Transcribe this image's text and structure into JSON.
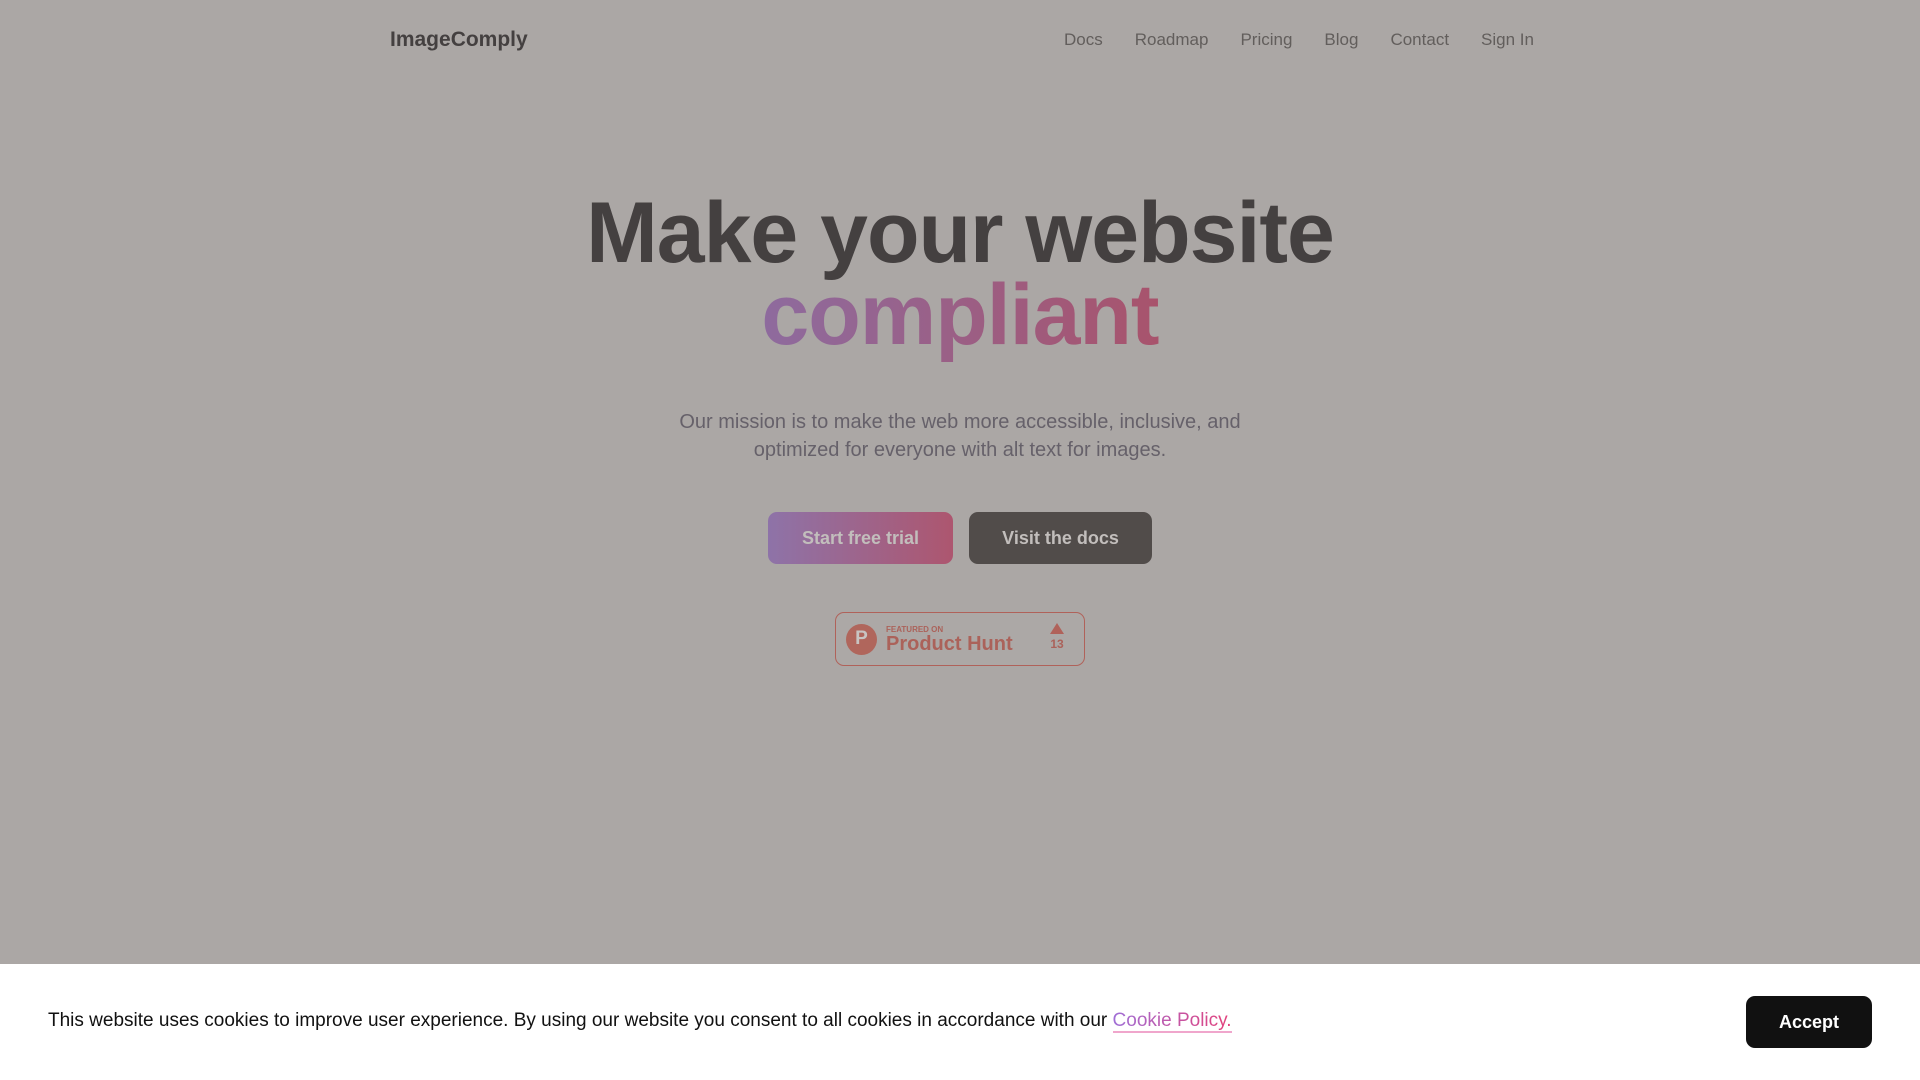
{
  "header": {
    "logo": "ImageComply",
    "nav": [
      "Docs",
      "Roadmap",
      "Pricing",
      "Blog",
      "Contact",
      "Sign In"
    ]
  },
  "hero": {
    "title_line1": "Make your website",
    "title_line2": "compliant",
    "subtitle_line1": "Our mission is to make the web more accessible, inclusive, and",
    "subtitle_line2": "optimized for everyone with alt text for images.",
    "primary_button": "Start free trial",
    "secondary_button": "Visit the docs"
  },
  "product_hunt": {
    "featured": "FEATURED ON",
    "name": "Product Hunt",
    "logo_letter": "P",
    "upvote_icon": "triangle-up-icon",
    "votes": "13"
  },
  "cookie": {
    "text": "This website uses cookies to improve user experience. By using our website you consent to all cookies in accordance with our ",
    "link": "Cookie Policy.",
    "accept": "Accept"
  },
  "colors": {
    "accent_start": "#a06fd6",
    "accent_end": "#e4407a",
    "product_hunt": "#ff6154"
  }
}
